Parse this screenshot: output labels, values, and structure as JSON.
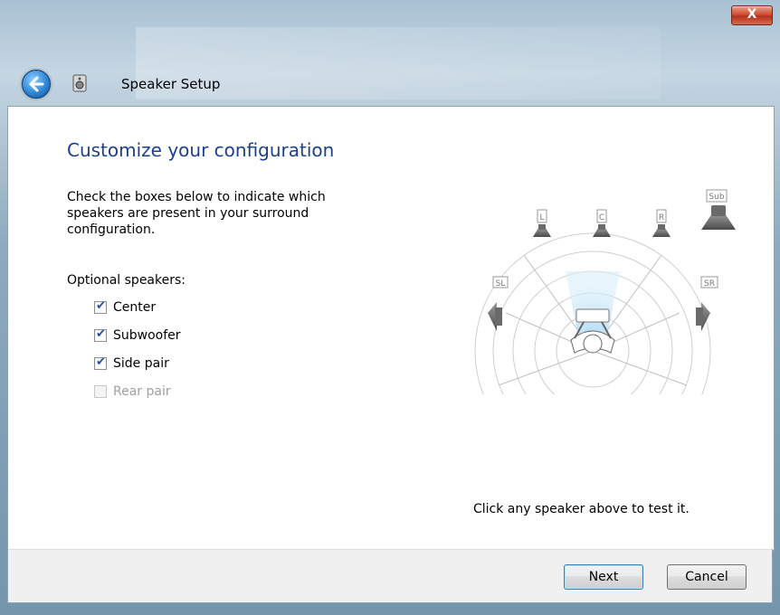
{
  "window": {
    "title": "Speaker Setup",
    "close_label": "X"
  },
  "content": {
    "heading": "Customize your configuration",
    "description": "Check the boxes below to indicate which speakers are present in your surround configuration.",
    "optional_label": "Optional speakers:",
    "checkboxes": [
      {
        "label": "Center",
        "checked": true,
        "enabled": true
      },
      {
        "label": "Subwoofer",
        "checked": true,
        "enabled": true
      },
      {
        "label": "Side pair",
        "checked": true,
        "enabled": true
      },
      {
        "label": "Rear pair",
        "checked": false,
        "enabled": false
      }
    ],
    "hint": "Click any speaker above to test it."
  },
  "diagram": {
    "speakers": [
      "L",
      "C",
      "R",
      "Sub",
      "SL",
      "SR"
    ]
  },
  "footer": {
    "next_label": "Next",
    "cancel_label": "Cancel"
  },
  "colors": {
    "heading": "#1c3f8f",
    "content_bg": "#ffffff",
    "footer_bg": "#f0f0f0",
    "accent_blue": "#2e86d6"
  }
}
